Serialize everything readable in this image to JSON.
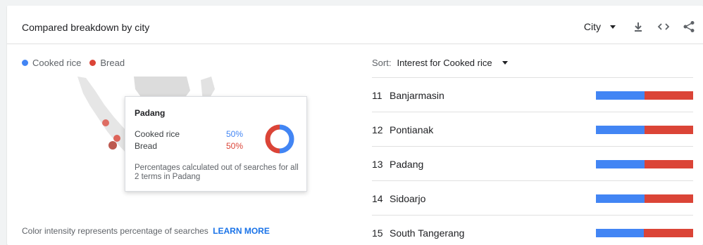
{
  "header": {
    "title": "Compared breakdown by city",
    "resolution_select": "City",
    "tools": [
      "download-icon",
      "embed-code-icon",
      "share-icon"
    ]
  },
  "legend": [
    {
      "label": "Cooked rice",
      "color": "#4285f4"
    },
    {
      "label": "Bread",
      "color": "#db4437"
    }
  ],
  "tooltip": {
    "title": "Padang",
    "rows": [
      {
        "label": "Cooked rice",
        "value": "50%",
        "share": 0.5,
        "color": "#4285f4"
      },
      {
        "label": "Bread",
        "value": "50%",
        "share": 0.5,
        "color": "#db4437"
      }
    ],
    "note": "Percentages calculated out of searches for all 2 terms in Padang"
  },
  "footnote": {
    "text": "Color intensity represents percentage of searches",
    "link": "LEARN MORE"
  },
  "sort": {
    "label": "Sort:",
    "value": "Interest for Cooked rice"
  },
  "ranking": [
    {
      "rank": "11",
      "name": "Banjarmasin",
      "cooked_rice": 0.5,
      "bread": 0.5
    },
    {
      "rank": "12",
      "name": "Pontianak",
      "cooked_rice": 0.5,
      "bread": 0.5
    },
    {
      "rank": "13",
      "name": "Padang",
      "cooked_rice": 0.5,
      "bread": 0.5
    },
    {
      "rank": "14",
      "name": "Sidoarjo",
      "cooked_rice": 0.5,
      "bread": 0.5
    },
    {
      "rank": "15",
      "name": "South Tangerang",
      "cooked_rice": 0.49,
      "bread": 0.51
    }
  ]
}
